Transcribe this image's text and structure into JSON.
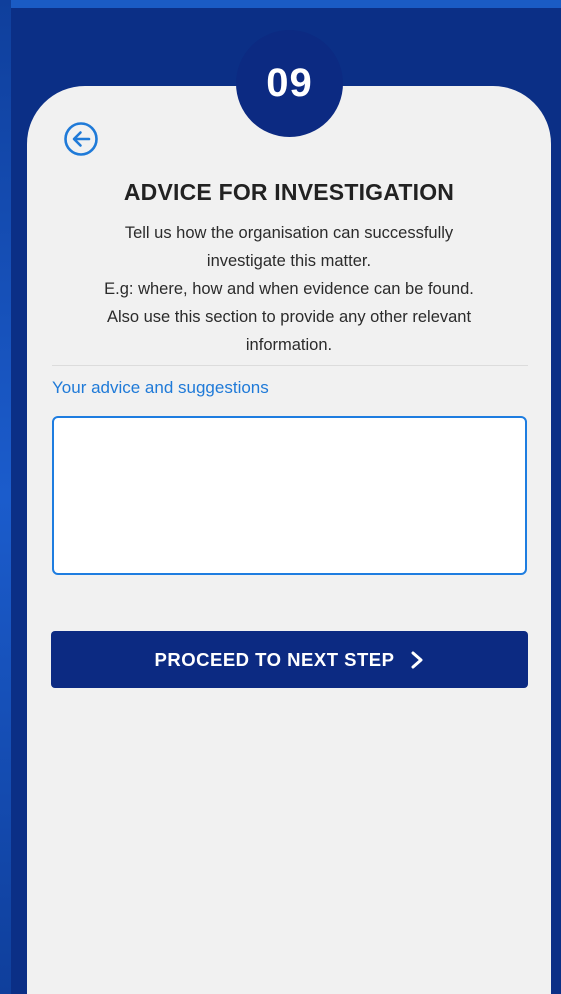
{
  "step": {
    "number": "09"
  },
  "header": {
    "back_icon": "arrow-left-circle-icon",
    "title": "ADVICE FOR INVESTIGATION"
  },
  "description": {
    "lines": [
      "Tell us how the organisation can successfully",
      "investigate this matter.",
      "E.g: where, how and when evidence can be found.",
      "Also use this section to provide any other relevant",
      "information."
    ]
  },
  "form": {
    "label": "Your advice and suggestions",
    "value": "",
    "placeholder": ""
  },
  "actions": {
    "proceed_label": "PROCEED TO NEXT STEP",
    "proceed_icon": "chevron-right-icon"
  },
  "colors": {
    "background": "#1551b8",
    "screen": "#0b2f86",
    "card": "#f1f1f1",
    "primary_dark": "#0c2a82",
    "accent_blue": "#1f7ad8"
  }
}
